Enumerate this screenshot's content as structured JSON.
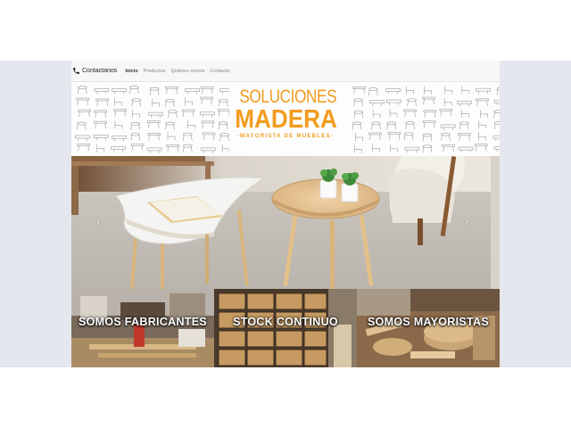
{
  "navbar": {
    "brand_label": "Contactanos",
    "brand_icon": "phone-icon",
    "items": [
      {
        "label": "Inicio",
        "active": true
      },
      {
        "label": "Productos",
        "active": false
      },
      {
        "label": "Quiénes somos",
        "active": false
      },
      {
        "label": "Contacto",
        "active": false
      }
    ]
  },
  "banner": {
    "logo_line1": "SOLUCIONES",
    "logo_line2": "MADERA",
    "logo_line3": "-MAYORISTA DE MUEBLES-",
    "accent_color": "#f29c1f"
  },
  "carousel": {
    "prev_icon": "chevron-left-icon",
    "next_icon": "chevron-right-icon",
    "prev_glyph": "‹",
    "next_glyph": "›"
  },
  "tiles": [
    {
      "label": "SOMOS FABRICANTES"
    },
    {
      "label": "STOCK CONTINUO"
    },
    {
      "label": "SOMOS MAYORISTAS"
    }
  ]
}
